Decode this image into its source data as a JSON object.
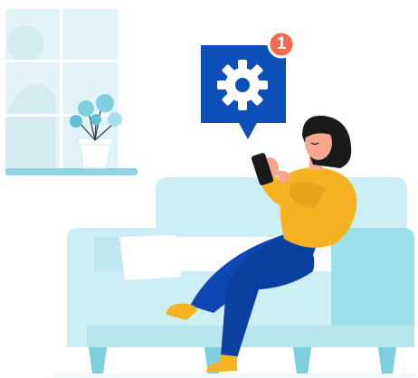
{
  "notification": {
    "count": "1",
    "icon": "gear-icon",
    "bubble_color": "#0c4fb8",
    "badge_color": "#f06b4f"
  },
  "palette": {
    "sky": "#e3f4f8",
    "sill": "#8fd5e3",
    "sofa": "#cdeef5",
    "sofa_shade": "#9ee0ea",
    "sweater": "#f6b321",
    "jeans": "#0d47b3",
    "skin": "#f6a78e",
    "hair": "#1a1a1a"
  }
}
